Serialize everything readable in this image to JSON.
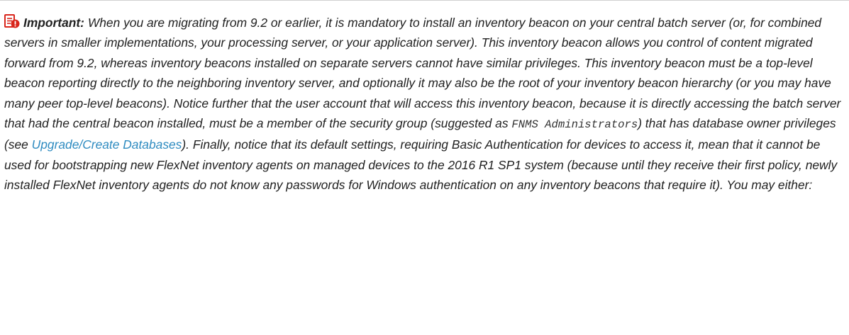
{
  "note": {
    "icon": "important-note-icon",
    "lead": "Important:",
    "text_1": " When you are migrating from 9.2 or earlier, it is mandatory to install an inventory beacon on your central batch server (or, for combined servers in smaller implementations, your processing server, or your application server). This inventory beacon allows you control of content migrated forward from 9.2, whereas inventory beacons installed on separate servers cannot have similar privileges. This inventory beacon must be a top-level beacon reporting directly to the neighboring inventory server, and optionally it may also be the root of your inventory beacon hierarchy (or you may have many peer top-level beacons). Notice further that the user account that will access this inventory beacon, because it is directly accessing the batch server that had the central beacon installed, must be a member of the security group (suggested as ",
    "code_group": "FNMS Administrators",
    "text_2": ") that has database owner privileges (see ",
    "link_label": "Upgrade/Create Databases",
    "text_3": "). Finally, notice that its default settings, requiring Basic Authentication for devices to access it, mean that it cannot be used for bootstrapping new FlexNet inventory agents on managed devices to the 2016 R1 SP1 system (because until they receive their first policy, newly installed FlexNet inventory agents do not know any passwords for Windows authentication on any inventory beacons that require it). You may either:"
  },
  "colors": {
    "text": "#222222",
    "link": "#2e8bc0",
    "icon_red": "#d9261c"
  }
}
